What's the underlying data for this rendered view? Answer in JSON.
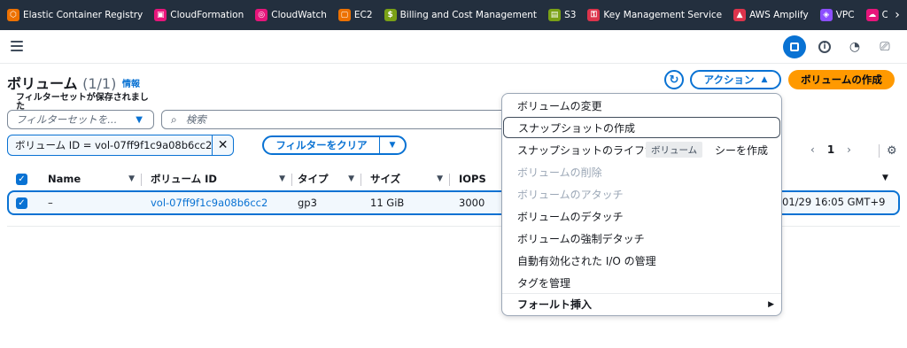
{
  "favorites": [
    {
      "label": "Elastic Container Registry",
      "color": "#ed7100",
      "icon": "ecr-icon"
    },
    {
      "label": "CloudFormation",
      "color": "#e7157b",
      "icon": "cloudformation-icon"
    },
    {
      "label": "CloudWatch",
      "color": "#e7157b",
      "icon": "cloudwatch-icon"
    },
    {
      "label": "EC2",
      "color": "#ed7100",
      "icon": "ec2-icon"
    },
    {
      "label": "Billing and Cost Management",
      "color": "#7aa116",
      "icon": "billing-icon"
    },
    {
      "label": "S3",
      "color": "#7aa116",
      "icon": "s3-icon"
    },
    {
      "label": "Key Management Service",
      "color": "#dd344c",
      "icon": "kms-icon"
    },
    {
      "label": "AWS Amplify",
      "color": "#dd344c",
      "icon": "amplify-icon"
    },
    {
      "label": "VPC",
      "color": "#8c4fff",
      "icon": "vpc-icon"
    },
    {
      "label": "CloudTrail",
      "color": "#e7157b",
      "icon": "cloudtrail-icon"
    }
  ],
  "header": {
    "title": "ボリューム",
    "count": "(1/1)",
    "info": "情報",
    "actions_label": "アクション",
    "create_label": "ボリュームの作成"
  },
  "filters": {
    "saved_label": "フィルターセットが保存されました",
    "saved_placeholder": "フィルターセットを...",
    "search_placeholder": "検索",
    "token": "ボリューム ID = vol-07ff9f1c9a08b6cc2",
    "clear_label": "フィルターをクリア"
  },
  "pagination": {
    "page": "1"
  },
  "table": {
    "columns": [
      "Name",
      "ボリューム ID",
      "タイプ",
      "サイズ",
      "IOPS"
    ],
    "row": {
      "name": "–",
      "volume_id": "vol-07ff9f1c9a08b6cc2",
      "type": "gp3",
      "size": "11 GiB",
      "iops": "3000",
      "created_partial": "01/29 16:05 GMT+9"
    }
  },
  "menu": {
    "items": [
      {
        "label": "ボリュームの変更",
        "state": "enabled"
      },
      {
        "label": "スナップショットの作成",
        "state": "focused"
      },
      {
        "label": "スナップショットのライフサ",
        "state": "enabled"
      },
      {
        "label": "ボリュームの削除",
        "state": "disabled"
      },
      {
        "label": "ボリュームのアタッチ",
        "state": "disabled"
      },
      {
        "label": "ボリュームのデタッチ",
        "state": "enabled"
      },
      {
        "label": "ボリュームの強制デタッチ",
        "state": "enabled"
      },
      {
        "label": "自動有効化された I/O の管理",
        "state": "enabled"
      },
      {
        "label": "タグを管理",
        "state": "enabled"
      }
    ],
    "lifecycle_suffix": "シーを作成",
    "group_label": "フォールト挿入",
    "tooltip": "ボリューム"
  }
}
